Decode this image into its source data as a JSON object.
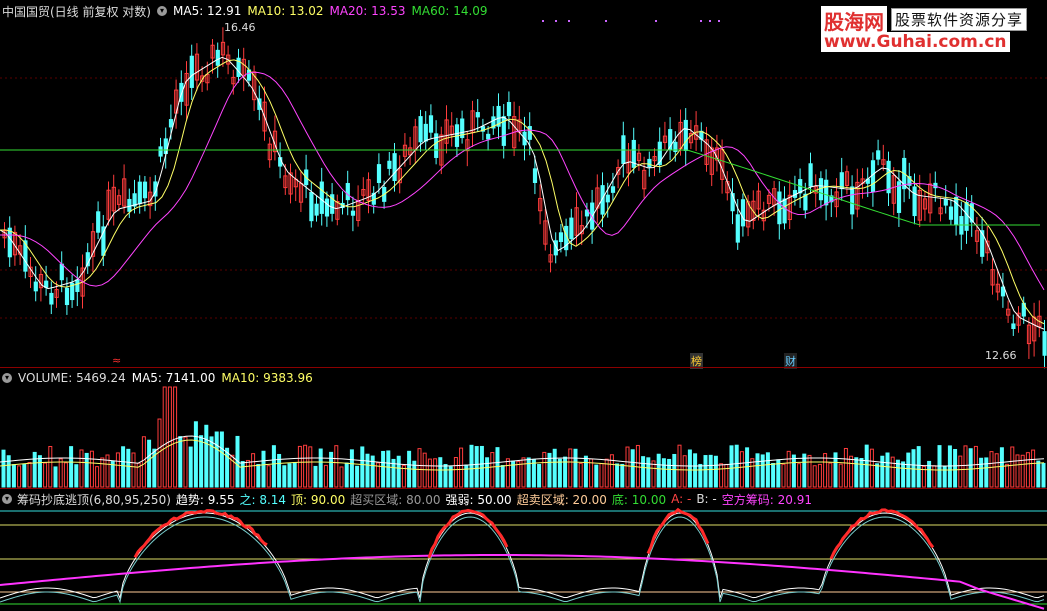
{
  "colors": {
    "up": "#ff3c3c",
    "down": "#54ffff",
    "ma5": "#ffffff",
    "ma10": "#ffff66",
    "ma20": "#ff44ff",
    "ma60": "#33dd33",
    "purple": "#ff33ff",
    "gridline": "#8b0000"
  },
  "price_panel": {
    "title": "中国国贸(日线 前复权 对数)",
    "ma5": "MA5: 12.91",
    "ma10": "MA10: 13.02",
    "ma20": "MA20: 13.53",
    "ma60": "MA60: 14.09",
    "high_label": "16.46",
    "low_label": "12.66",
    "marker_bang": "榜",
    "marker_cai": "财",
    "marker_left": "≈"
  },
  "volume_panel": {
    "volume": "VOLUME: 5469.24",
    "ma5": "MA5: 7141.00",
    "ma10": "MA10: 9383.96"
  },
  "indicator_panel": {
    "name": "筹码抄底逃顶(6,80,95,250)",
    "trend": "趋势: 9.55",
    "zhi": "之: 8.14",
    "top": "顶: 90.00",
    "overbought": "超买区域: 80.00",
    "strength": "强弱: 50.00",
    "oversold": "超卖区域: 20.00",
    "bottom": "底: 10.00",
    "a": "A: -",
    "b": "B: -",
    "short": "空方筹码: 20.91"
  },
  "watermark": {
    "brand": "股海网",
    "slogan": "股票软件资源分享",
    "url": "www.Guhai.com.cn"
  }
}
